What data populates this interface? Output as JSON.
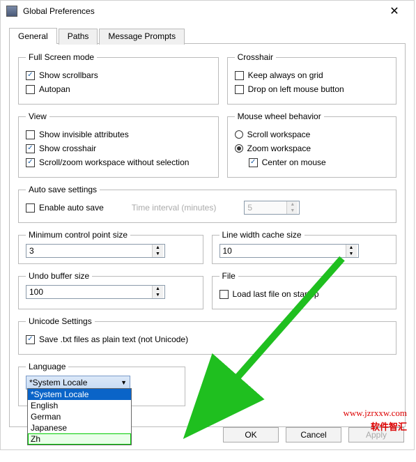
{
  "title": "Global Preferences",
  "tabs": {
    "general": "General",
    "paths": "Paths",
    "prompts": "Message Prompts"
  },
  "fullscreen": {
    "legend": "Full Screen mode",
    "scrollbars": "Show scrollbars",
    "autopan": "Autopan"
  },
  "crosshair": {
    "legend": "Crosshair",
    "keep": "Keep always on grid",
    "drop": "Drop on left mouse button"
  },
  "view": {
    "legend": "View",
    "invisible": "Show invisible attributes",
    "cross": "Show crosshair",
    "scroll": "Scroll/zoom workspace without selection"
  },
  "wheel": {
    "legend": "Mouse wheel behavior",
    "scroll": "Scroll workspace",
    "zoom": "Zoom workspace",
    "center": "Center on mouse"
  },
  "autosave": {
    "legend": "Auto save settings",
    "enable": "Enable auto save",
    "interval_label": "Time interval (minutes)",
    "interval_value": "5"
  },
  "minpt": {
    "legend": "Minimum control point size",
    "value": "3"
  },
  "linewidth": {
    "legend": "Line width cache size",
    "value": "10"
  },
  "undo": {
    "legend": "Undo buffer size",
    "value": "100"
  },
  "file": {
    "legend": "File",
    "load": "Load last file on startup"
  },
  "unicode": {
    "legend": "Unicode Settings",
    "save": "Save .txt files as plain text (not Unicode)"
  },
  "language": {
    "legend": "Language",
    "selected": "*System Locale",
    "options": [
      "*System Locale",
      "English",
      "German",
      "Japanese",
      "Zh"
    ]
  },
  "buttons": {
    "ok": "OK",
    "cancel": "Cancel",
    "apply": "Apply"
  },
  "watermark": {
    "url": "www.jzrxxw.com",
    "text": "软件智汇"
  }
}
